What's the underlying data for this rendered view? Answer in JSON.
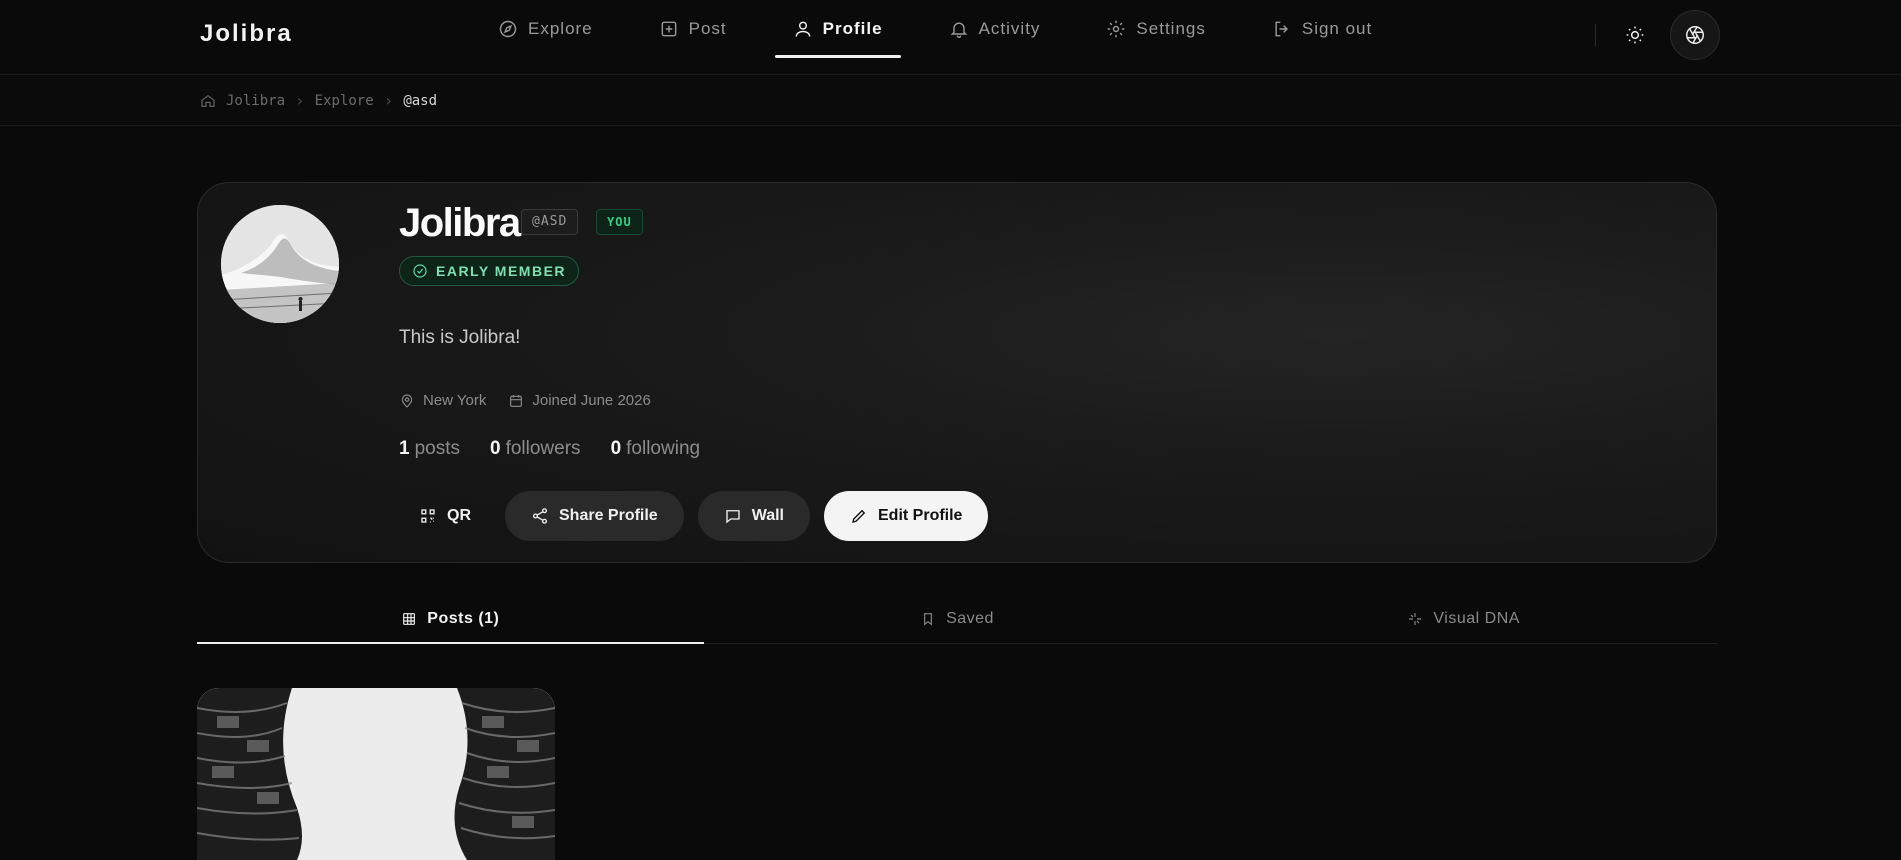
{
  "brand": {
    "name": "Jolibra"
  },
  "nav": {
    "items": [
      {
        "label": "Explore",
        "icon": "compass-icon"
      },
      {
        "label": "Post",
        "icon": "plus-square-icon"
      },
      {
        "label": "Profile",
        "icon": "user-icon",
        "active": true
      },
      {
        "label": "Activity",
        "icon": "bell-icon"
      },
      {
        "label": "Settings",
        "icon": "gear-icon"
      },
      {
        "label": "Sign out",
        "icon": "sign-out-icon"
      }
    ]
  },
  "breadcrumb": {
    "items": [
      "Jolibra",
      "Explore",
      "@asd"
    ]
  },
  "profile": {
    "name": "Jolibra",
    "handle": "@ASD",
    "you_badge": "YOU",
    "member_badge": "EARLY MEMBER",
    "bio": "This is Jolibra!",
    "location": "New York",
    "joined": "Joined June 2026",
    "stats": {
      "posts_count": "1",
      "posts_label": "posts",
      "followers_count": "0",
      "followers_label": "followers",
      "following_count": "0",
      "following_label": "following"
    },
    "actions": {
      "qr": "QR",
      "share": "Share Profile",
      "wall": "Wall",
      "edit": "Edit Profile"
    }
  },
  "tabs": [
    {
      "label": "Posts (1)",
      "icon": "grid-icon",
      "active": true
    },
    {
      "label": "Saved",
      "icon": "bookmark-icon"
    },
    {
      "label": "Visual DNA",
      "icon": "sparkle-icon"
    }
  ],
  "colors": {
    "background": "#0a0a0a",
    "accent_green": "#2fd183",
    "primary_button": "#f4f4f4"
  }
}
